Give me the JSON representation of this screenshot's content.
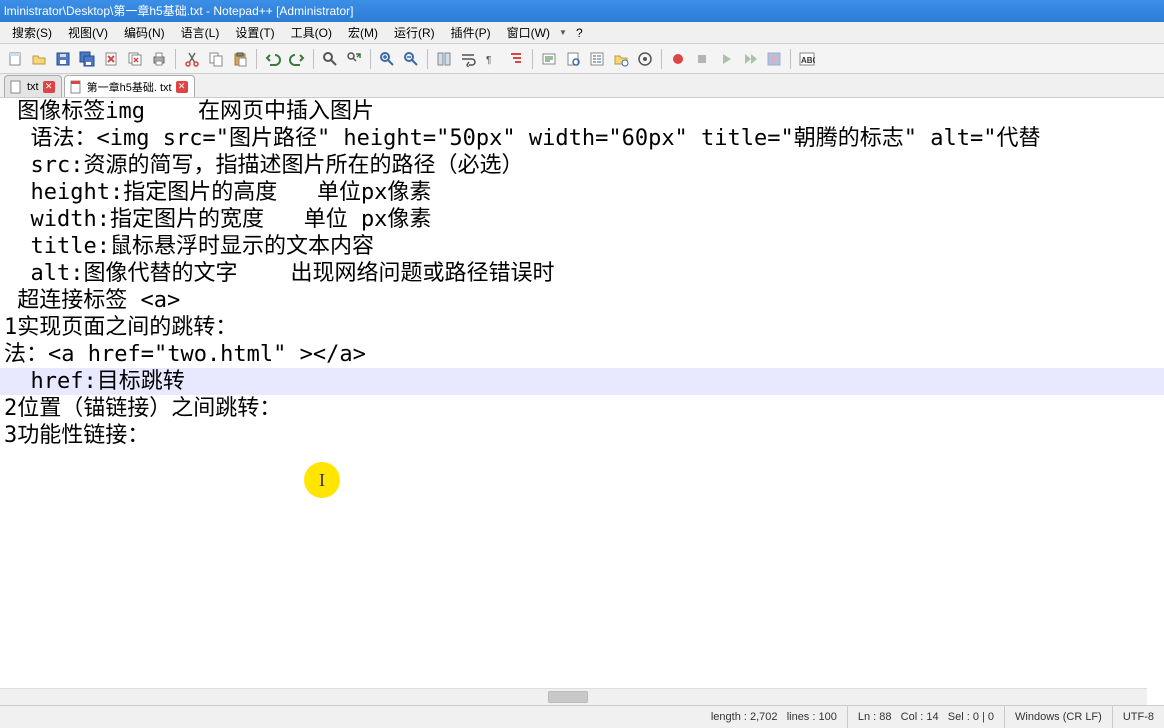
{
  "title_bar": "lministrator\\Desktop\\第一章h5基础.txt - Notepad++ [Administrator]",
  "menu": {
    "search": "搜索(S)",
    "view": "视图(V)",
    "encoding": "编码(N)",
    "language": "语言(L)",
    "settings": "设置(T)",
    "tools": "工具(O)",
    "macro": "宏(M)",
    "run": "运行(R)",
    "plugins": "插件(P)",
    "window": "窗口(W)",
    "help": "?"
  },
  "toolbar_icons": {
    "new": "new-file-icon",
    "open": "open-file-icon",
    "save": "save-icon",
    "saveall": "save-all-icon",
    "close": "close-file-icon",
    "closeall": "close-all-icon",
    "print": "print-icon",
    "cut": "cut-icon",
    "copy": "copy-icon",
    "paste": "paste-icon",
    "undo": "undo-icon",
    "redo": "redo-icon",
    "find": "find-icon",
    "replace": "replace-icon",
    "zoomin": "zoom-in-icon",
    "zoomout": "zoom-out-icon",
    "sync": "sync-icon",
    "wrap": "word-wrap-icon",
    "whitespace": "show-whitespace-icon",
    "indent": "indent-guide-icon",
    "udl": "user-language-icon",
    "docmap": "doc-map-icon",
    "funclist": "function-list-icon",
    "folder": "folder-workspace-icon",
    "monitor": "monitor-icon",
    "record": "record-icon",
    "play": "play-icon",
    "playtimes": "play-multiple-icon",
    "savemacro": "save-macro-icon",
    "spellcheck": "spellcheck-icon"
  },
  "tabs": {
    "t0_label": "txt",
    "t1_label": "第一章h5基础. txt"
  },
  "editor": {
    "l0": "",
    "l1": " 图像标签img    在网页中插入图片",
    "l2": "",
    "l3": "",
    "l4": "  语法：<img src=\"图片路径\" height=\"50px\" width=\"60px\" title=\"朝腾的标志\" alt=\"代替",
    "l5": "  src:资源的简写，指描述图片所在的路径（必选）",
    "l6": "  height:指定图片的高度   单位px像素",
    "l7": "  width:指定图片的宽度   单位 px像素",
    "l8": "  title:鼠标悬浮时显示的文本内容",
    "l9": "  alt:图像代替的文字    出现网络问题或路径错误时",
    "l10": "",
    "l11": "",
    "l12": " 超连接标签 <a>",
    "l13": "1实现页面之间的跳转：",
    "l14": "法：<a href=\"two.html\" ></a>",
    "l15": "  href:目标跳转",
    "l16": "",
    "l17": "",
    "l18": "",
    "l19": "2位置（锚链接）之间跳转：",
    "l20": "",
    "l21": "",
    "l22": "",
    "l23": "3功能性链接："
  },
  "status": {
    "length": "length : 2,702",
    "lines": "lines : 100",
    "ln": "Ln : 88",
    "col": "Col : 14",
    "sel": "Sel : 0 | 0",
    "eol": "Windows (CR LF)",
    "encoding": "UTF-8"
  },
  "cursor_marker": "I"
}
